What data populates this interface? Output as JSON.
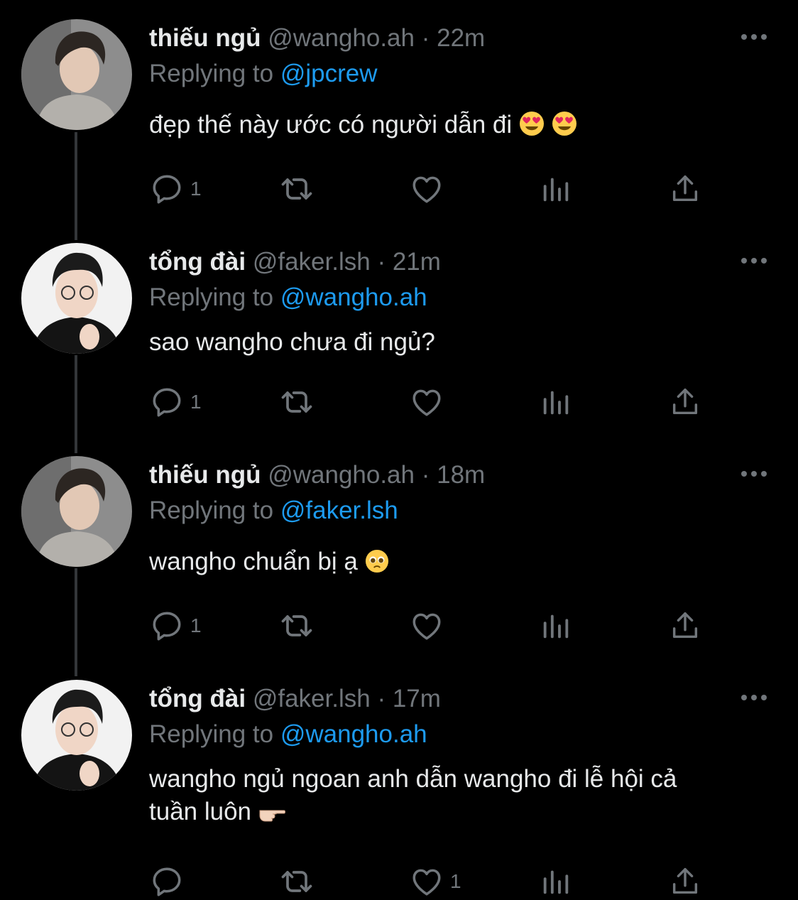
{
  "thread": [
    {
      "name": "thiếu ngủ",
      "handle": "@wangho.ah",
      "dot": "·",
      "time": "22m",
      "replying_prefix": "Replying to",
      "replying_to": "@jpcrew",
      "text": "đẹp thế này ước có người dẫn đi",
      "emoji": "heart-eyes-emoji",
      "emoji_count": 2,
      "reply_count": "1",
      "like_count": ""
    },
    {
      "name": "tổng đài",
      "handle": "@faker.lsh",
      "dot": "·",
      "time": "21m",
      "replying_prefix": "Replying to",
      "replying_to": "@wangho.ah",
      "text": "sao wangho chưa đi ngủ?",
      "reply_count": "1",
      "like_count": ""
    },
    {
      "name": "thiếu ngủ",
      "handle": "@wangho.ah",
      "dot": "·",
      "time": "18m",
      "replying_prefix": "Replying to",
      "replying_to": "@faker.lsh",
      "text": "wangho chuẩn bị ạ",
      "emoji": "pleading-face-emoji",
      "reply_count": "1",
      "like_count": ""
    },
    {
      "name": "tổng đài",
      "handle": "@faker.lsh",
      "dot": "·",
      "time": "17m",
      "replying_prefix": "Replying to",
      "replying_to": "@wangho.ah",
      "text_line1": "wangho ngủ ngoan anh dẫn wangho đi lễ hội cả",
      "text_line2": "tuần luôn",
      "emoji": "pointing-hand-emoji",
      "reply_count": "",
      "like_count": "1"
    }
  ],
  "colors": {
    "background": "#000000",
    "primary_text": "#e7e9ea",
    "secondary_text": "#71767b",
    "link": "#1d9bf0",
    "thread_line": "#333639"
  }
}
